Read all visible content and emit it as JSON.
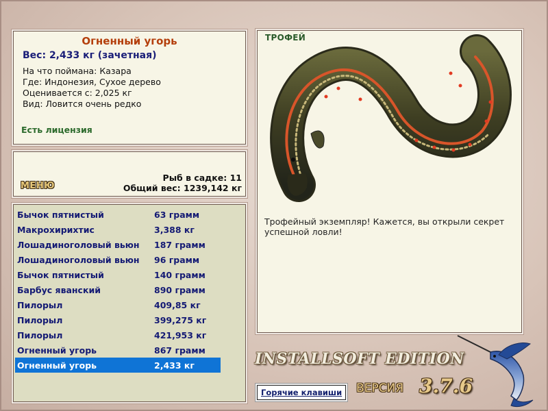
{
  "catch": {
    "title": "Огненный угорь",
    "weight": "Вес: 2,433 кг (зачетная)",
    "bait": "На что поймана: Казара",
    "place": "Где: Индонезия, Сухое дерево",
    "price": "Оценивается с: 2,025 кг",
    "rarity": "Вид: Ловится очень редко",
    "license": "Есть лицензия"
  },
  "stats": {
    "menu_label": "МЕНЮ",
    "fish_count": "Рыб в садке: 11",
    "total_weight": "Общий вес: 1239,142 кг"
  },
  "keepnet": {
    "rows": [
      {
        "name": "Бычок пятнистый",
        "weight": "63 грамм"
      },
      {
        "name": "Макрохирихтис",
        "weight": "3,388 кг"
      },
      {
        "name": "Лошадиноголовый вьюн",
        "weight": "187 грамм"
      },
      {
        "name": "Лошадиноголовый вьюн",
        "weight": "96 грамм"
      },
      {
        "name": "Бычок пятнистый",
        "weight": "140 грамм"
      },
      {
        "name": "Барбус яванский",
        "weight": "890 грамм"
      },
      {
        "name": "Пилорыл",
        "weight": "409,85 кг"
      },
      {
        "name": "Пилорыл",
        "weight": "399,275 кг"
      },
      {
        "name": "Пилорыл",
        "weight": "421,953 кг"
      },
      {
        "name": "Огненный угорь",
        "weight": "867 грамм"
      },
      {
        "name": "Огненный угорь",
        "weight": "2,433 кг"
      }
    ],
    "selected_index": 10
  },
  "trophy": {
    "label": "ТРОФЕЙ",
    "description": "Трофейный экземпляр! Кажется, вы открыли секрет успешной ловли!"
  },
  "branding": {
    "edition": "INSTALLSOFT EDITION",
    "version_label": "ВЕРСИЯ",
    "version_number": "3.7.6"
  },
  "hotkeys_label": "Горячие клавиши",
  "colors": {
    "panel_bg": "#f7f5e6",
    "list_bg": "#ddddc2",
    "selection": "#0f74d6",
    "title": "#b43f0c",
    "list_text": "#141a74",
    "license": "#2c6a2c"
  },
  "icons": {
    "trophy_image": "fire-eel-icon",
    "logo_fish": "marlin-icon"
  }
}
